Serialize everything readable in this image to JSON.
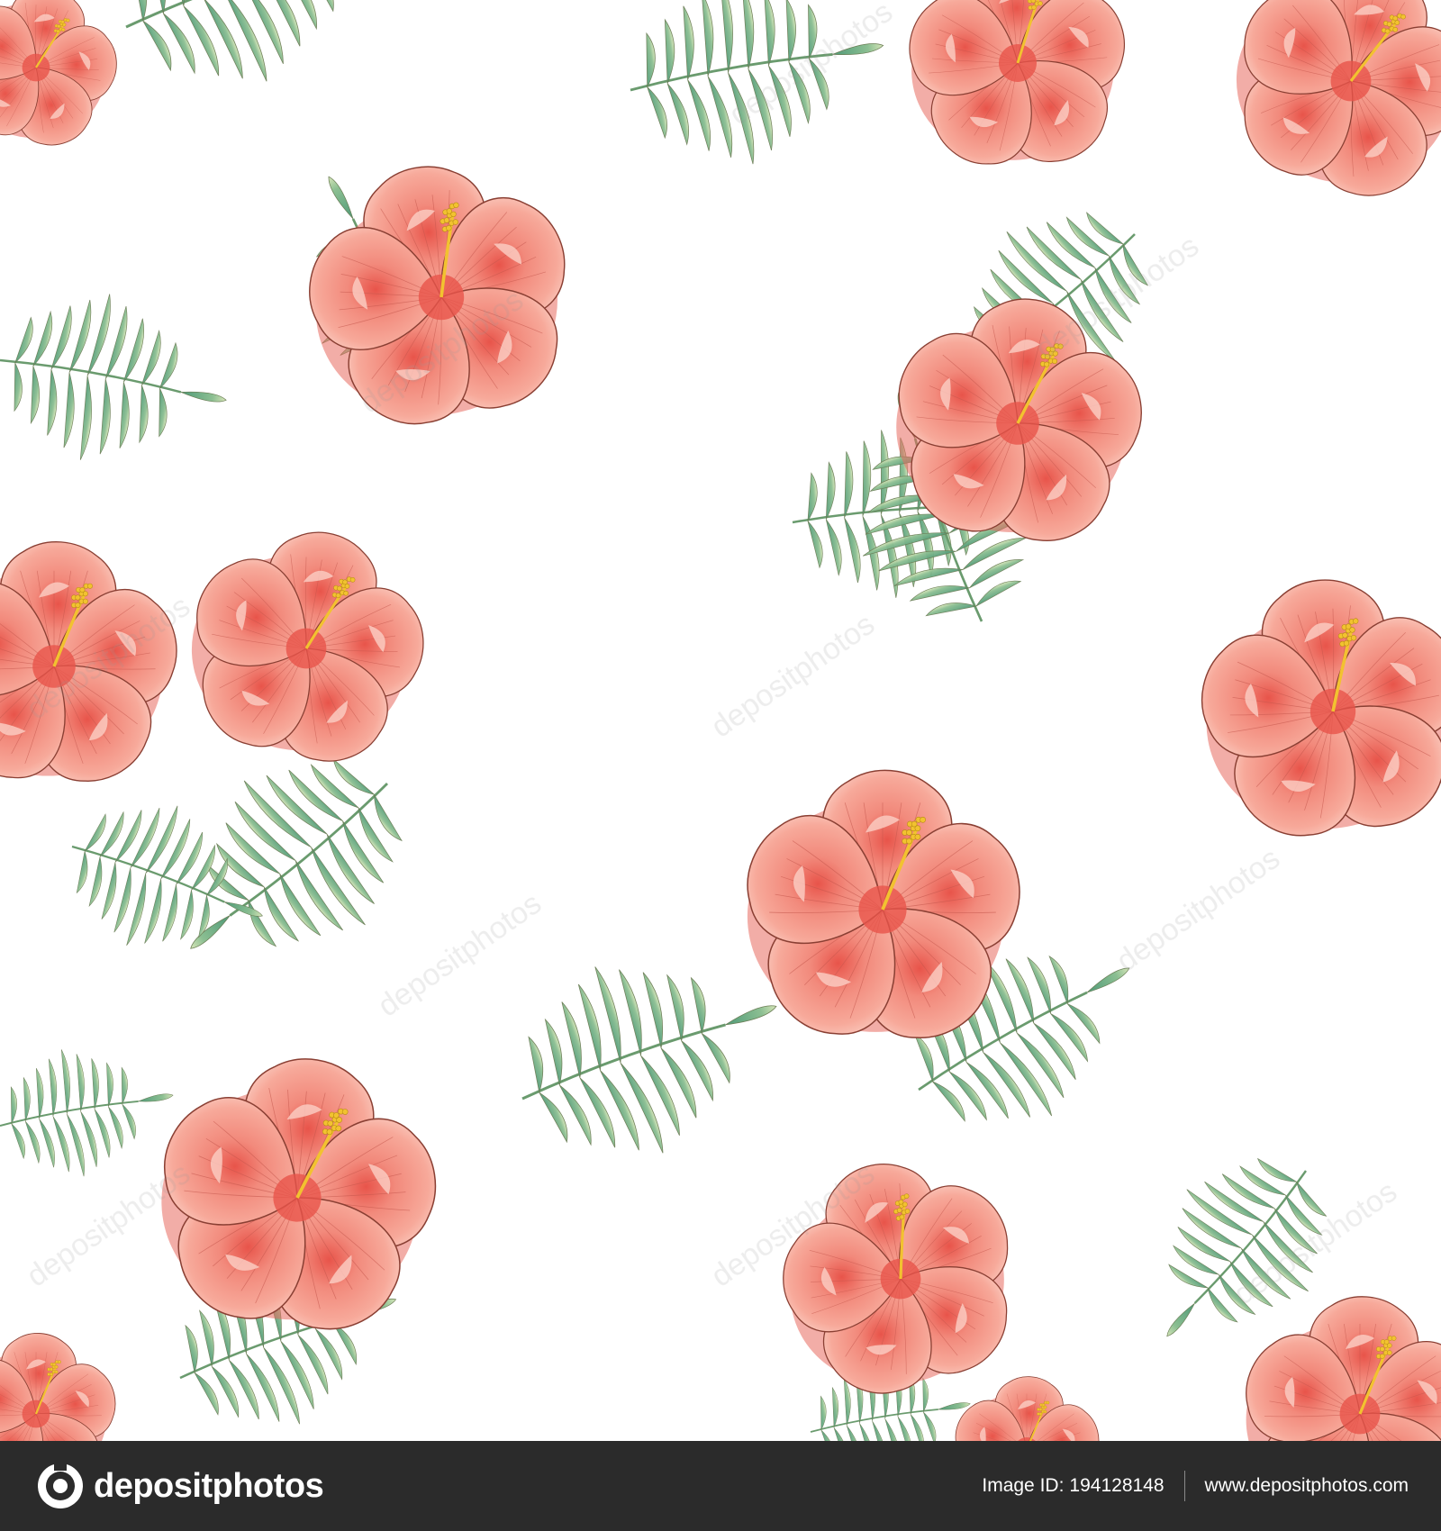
{
  "image": {
    "description_type": "seamless floral pattern",
    "colors": {
      "background": "#ffffff",
      "petal": "#f7a99a",
      "petal_light": "#fbd0c5",
      "petal_center": "#e8544a",
      "petal_outline": "#8a3f33",
      "stamen": "#f2c230",
      "leaf_dark": "#4f9a78",
      "leaf_light": "#b9d6a3",
      "stem": "#6a9b6e"
    }
  },
  "footer": {
    "brand_text": "depositphotos",
    "image_id_label": "Image ID:",
    "image_id_value": "194128148",
    "site_url": "www.depositphotos.com",
    "background_color": "#2b2b2b",
    "text_color": "#ffffff"
  },
  "watermark": {
    "text": "depositphotos"
  }
}
